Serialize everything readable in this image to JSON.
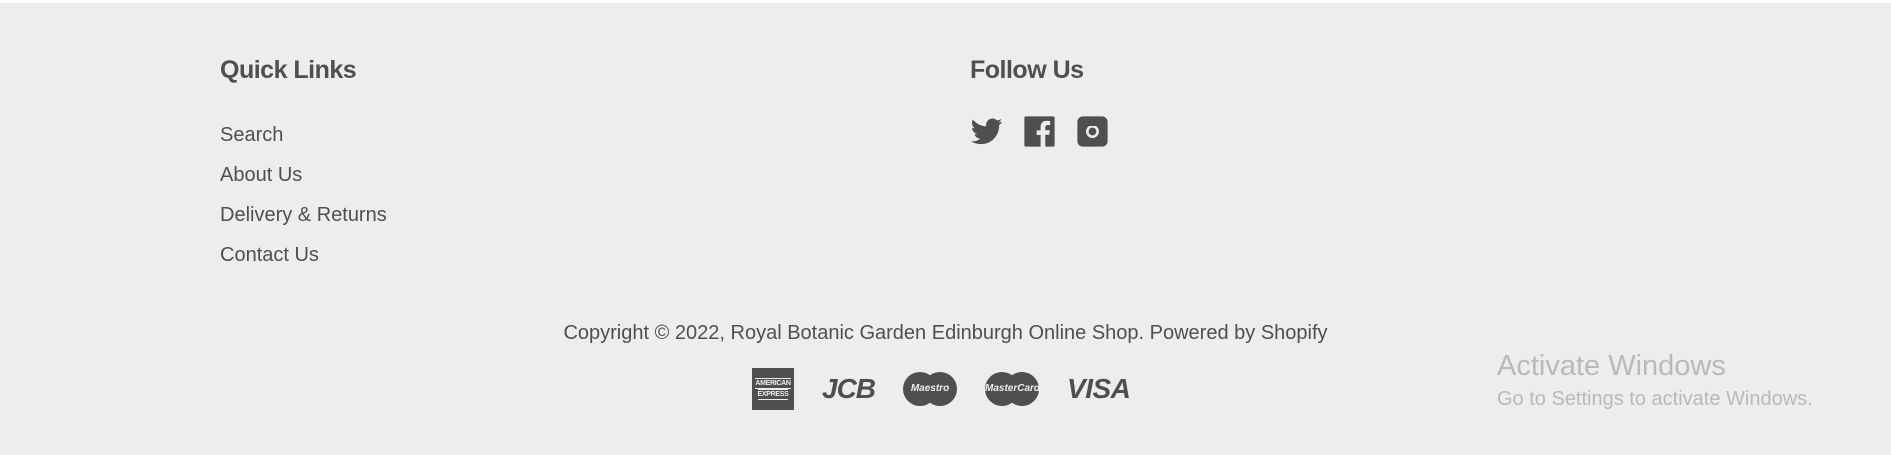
{
  "quick_links": {
    "heading": "Quick Links",
    "items": [
      "Search",
      "About Us",
      "Delivery & Returns",
      "Contact Us"
    ]
  },
  "follow_us": {
    "heading": "Follow Us",
    "icons": [
      "twitter-icon",
      "facebook-icon",
      "instagram-icon"
    ]
  },
  "copyright": "Copyright © 2022, Royal Botanic Garden Edinburgh Online Shop. Powered by Shopify",
  "payments": {
    "amex_line1": "AMERICAN",
    "amex_line2": "EXPRESS",
    "jcb": "JCB",
    "maestro": "Maestro",
    "mastercard": "MasterCard",
    "visa": "VISA"
  },
  "activate_windows": {
    "title": "Activate Windows",
    "subtitle": "Go to Settings to activate Windows."
  },
  "colors": {
    "background": "#ededed",
    "text": "#4f4f4f",
    "watermark": "#b9b9b9"
  }
}
